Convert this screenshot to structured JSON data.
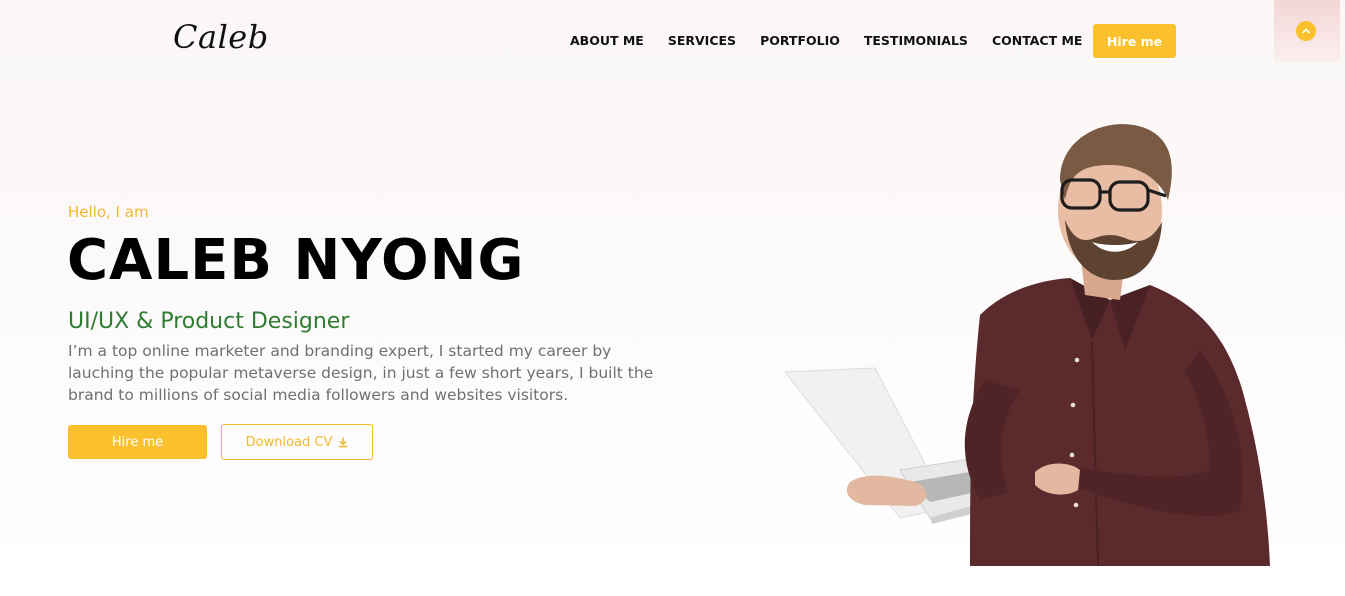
{
  "header": {
    "logo": "Caleb",
    "nav": [
      "ABOUT ME",
      "SERVICES",
      "PORTFOLIO",
      "TESTIMONIALS",
      "CONTACT ME"
    ],
    "hire_label": "Hire me",
    "scroll_top_icon": "chevron-up-icon"
  },
  "hero": {
    "greeting": "Hello, I am",
    "name": "CALEB NYONG",
    "role": "UI/UX & Product Designer",
    "description": "I’m a top online marketer and branding expert, I started my career by lauching the popular metaverse design, in just a few short years, I built the brand to millions of social media followers and websites visitors.",
    "hire_label": "Hire me",
    "download_label": "Download CV",
    "download_icon": "download-icon"
  },
  "colors": {
    "accent": "#fbc02d",
    "role": "#2e7d32",
    "text": "#707070"
  }
}
